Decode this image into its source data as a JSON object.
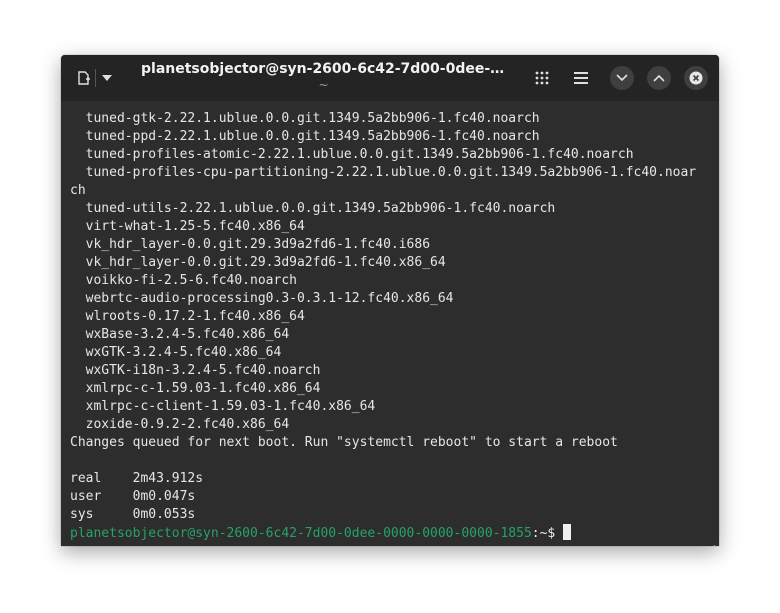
{
  "window": {
    "title": "planetsobjector@syn-2600-6c42-7d00-0dee-0000-...",
    "subtitle": "~"
  },
  "titlebar": {
    "new_tab_icon": "new-tab-icon",
    "dropdown_icon": "chevron-down-icon",
    "buttons": [
      "grid-icon",
      "menu-icon",
      "minimize-icon",
      "maximize-icon",
      "close-icon"
    ]
  },
  "terminal": {
    "lines": [
      "  tuned-gtk-2.22.1.ublue.0.0.git.1349.5a2bb906-1.fc40.noarch",
      "  tuned-ppd-2.22.1.ublue.0.0.git.1349.5a2bb906-1.fc40.noarch",
      "  tuned-profiles-atomic-2.22.1.ublue.0.0.git.1349.5a2bb906-1.fc40.noarch",
      "  tuned-profiles-cpu-partitioning-2.22.1.ublue.0.0.git.1349.5a2bb906-1.fc40.noar",
      "ch",
      "  tuned-utils-2.22.1.ublue.0.0.git.1349.5a2bb906-1.fc40.noarch",
      "  virt-what-1.25-5.fc40.x86_64",
      "  vk_hdr_layer-0.0.git.29.3d9a2fd6-1.fc40.i686",
      "  vk_hdr_layer-0.0.git.29.3d9a2fd6-1.fc40.x86_64",
      "  voikko-fi-2.5-6.fc40.noarch",
      "  webrtc-audio-processing0.3-0.3.1-12.fc40.x86_64",
      "  wlroots-0.17.2-1.fc40.x86_64",
      "  wxBase-3.2.4-5.fc40.x86_64",
      "  wxGTK-3.2.4-5.fc40.x86_64",
      "  wxGTK-i18n-3.2.4-5.fc40.noarch",
      "  xmlrpc-c-1.59.03-1.fc40.x86_64",
      "  xmlrpc-c-client-1.59.03-1.fc40.x86_64",
      "  zoxide-0.9.2-2.fc40.x86_64",
      "Changes queued for next boot. Run \"systemctl reboot\" to start a reboot",
      "",
      "real\t2m43.912s",
      "user\t0m0.047s",
      "sys\t0m0.053s"
    ],
    "prompt_user": "planetsobjector@syn-2600-6c42-7d00-0dee-0000-0000-0000-1855",
    "prompt_dir": ":~$ "
  },
  "colors": {
    "background": "#2d2d2d",
    "titlebar": "#242424",
    "text": "#e6e6e6",
    "prompt_green": "#26a269"
  }
}
